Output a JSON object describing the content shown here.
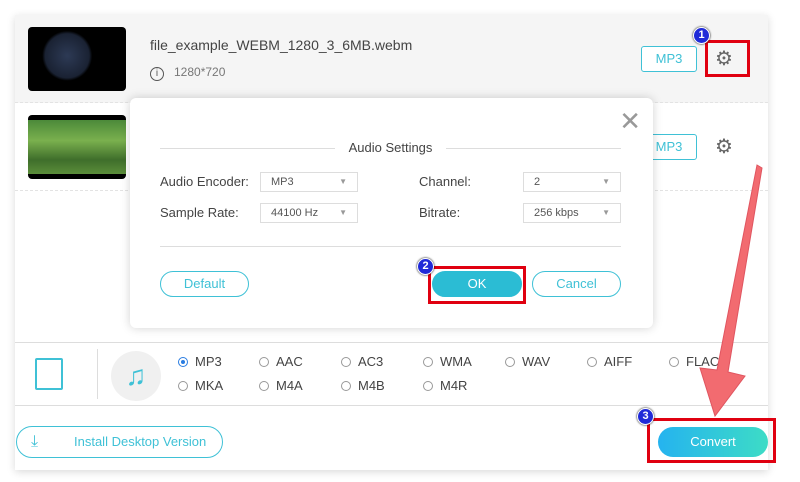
{
  "files": [
    {
      "name": "file_example_WEBM_1280_3_6MB.webm",
      "resolution": "1280*720",
      "format": "MP3"
    },
    {
      "format": "MP3"
    }
  ],
  "modal": {
    "title": "Audio Settings",
    "encoder_label": "Audio Encoder:",
    "encoder_value": "MP3",
    "channel_label": "Channel:",
    "channel_value": "2",
    "sample_rate_label": "Sample Rate:",
    "sample_rate_value": "44100 Hz",
    "bitrate_label": "Bitrate:",
    "bitrate_value": "256 kbps",
    "default_label": "Default",
    "ok_label": "OK",
    "cancel_label": "Cancel"
  },
  "formats": {
    "row1": [
      "MP3",
      "AAC",
      "AC3",
      "WMA",
      "WAV",
      "AIFF",
      "FLAC"
    ],
    "row2": [
      "MKA",
      "M4A",
      "M4B",
      "M4R"
    ],
    "selected": "MP3"
  },
  "install_label": "Install Desktop Version",
  "convert_label": "Convert",
  "badges": [
    "1",
    "2",
    "3"
  ],
  "colors": {
    "accent": "#3fc1d6",
    "highlight": "#e00010",
    "badge": "#1f2ad8",
    "arrow": "#f26b70"
  }
}
